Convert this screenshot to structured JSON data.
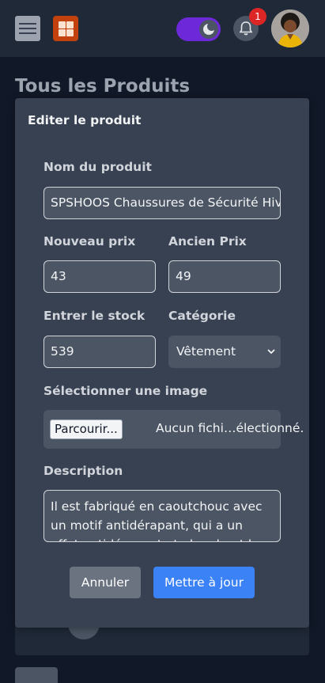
{
  "header": {
    "menu_icon": "hamburger-icon",
    "logo_icon": "grid-logo-icon",
    "theme_icon": "moon-icon",
    "notification_icon": "bell-icon",
    "notification_count": "1"
  },
  "page": {
    "title": "Tous les Produits"
  },
  "modal": {
    "title": "Editer le produit",
    "name_label": "Nom du produit",
    "name_value": "SPSHOOS Chaussures de Sécurité Hiver",
    "new_price_label": "Nouveau prix",
    "new_price_value": "43",
    "old_price_label": "Ancien Prix",
    "old_price_value": "49",
    "stock_label": "Entrer le stock",
    "stock_value": "539",
    "category_label": "Catégorie",
    "category_value": "Vêtement",
    "image_label": "Sélectionner une image",
    "browse_button": "Parcourir...",
    "no_file_text": "Aucun fichi…électionné.",
    "description_label": "Description",
    "description_value": "Il est fabriqué en caoutchouc avec un motif antidérapant, qui a un effet antidérapant et absorbant les chocs",
    "cancel_button": "Annuler",
    "update_button": "Mettre à jour"
  },
  "colors": {
    "background": "#111827",
    "navbar": "#1f2937",
    "modal": "#374151",
    "input": "#4b5563",
    "primary": "#3b82f6",
    "toggle": "#6d28d9",
    "badge": "#dc2626",
    "logo": "#c2410c"
  }
}
